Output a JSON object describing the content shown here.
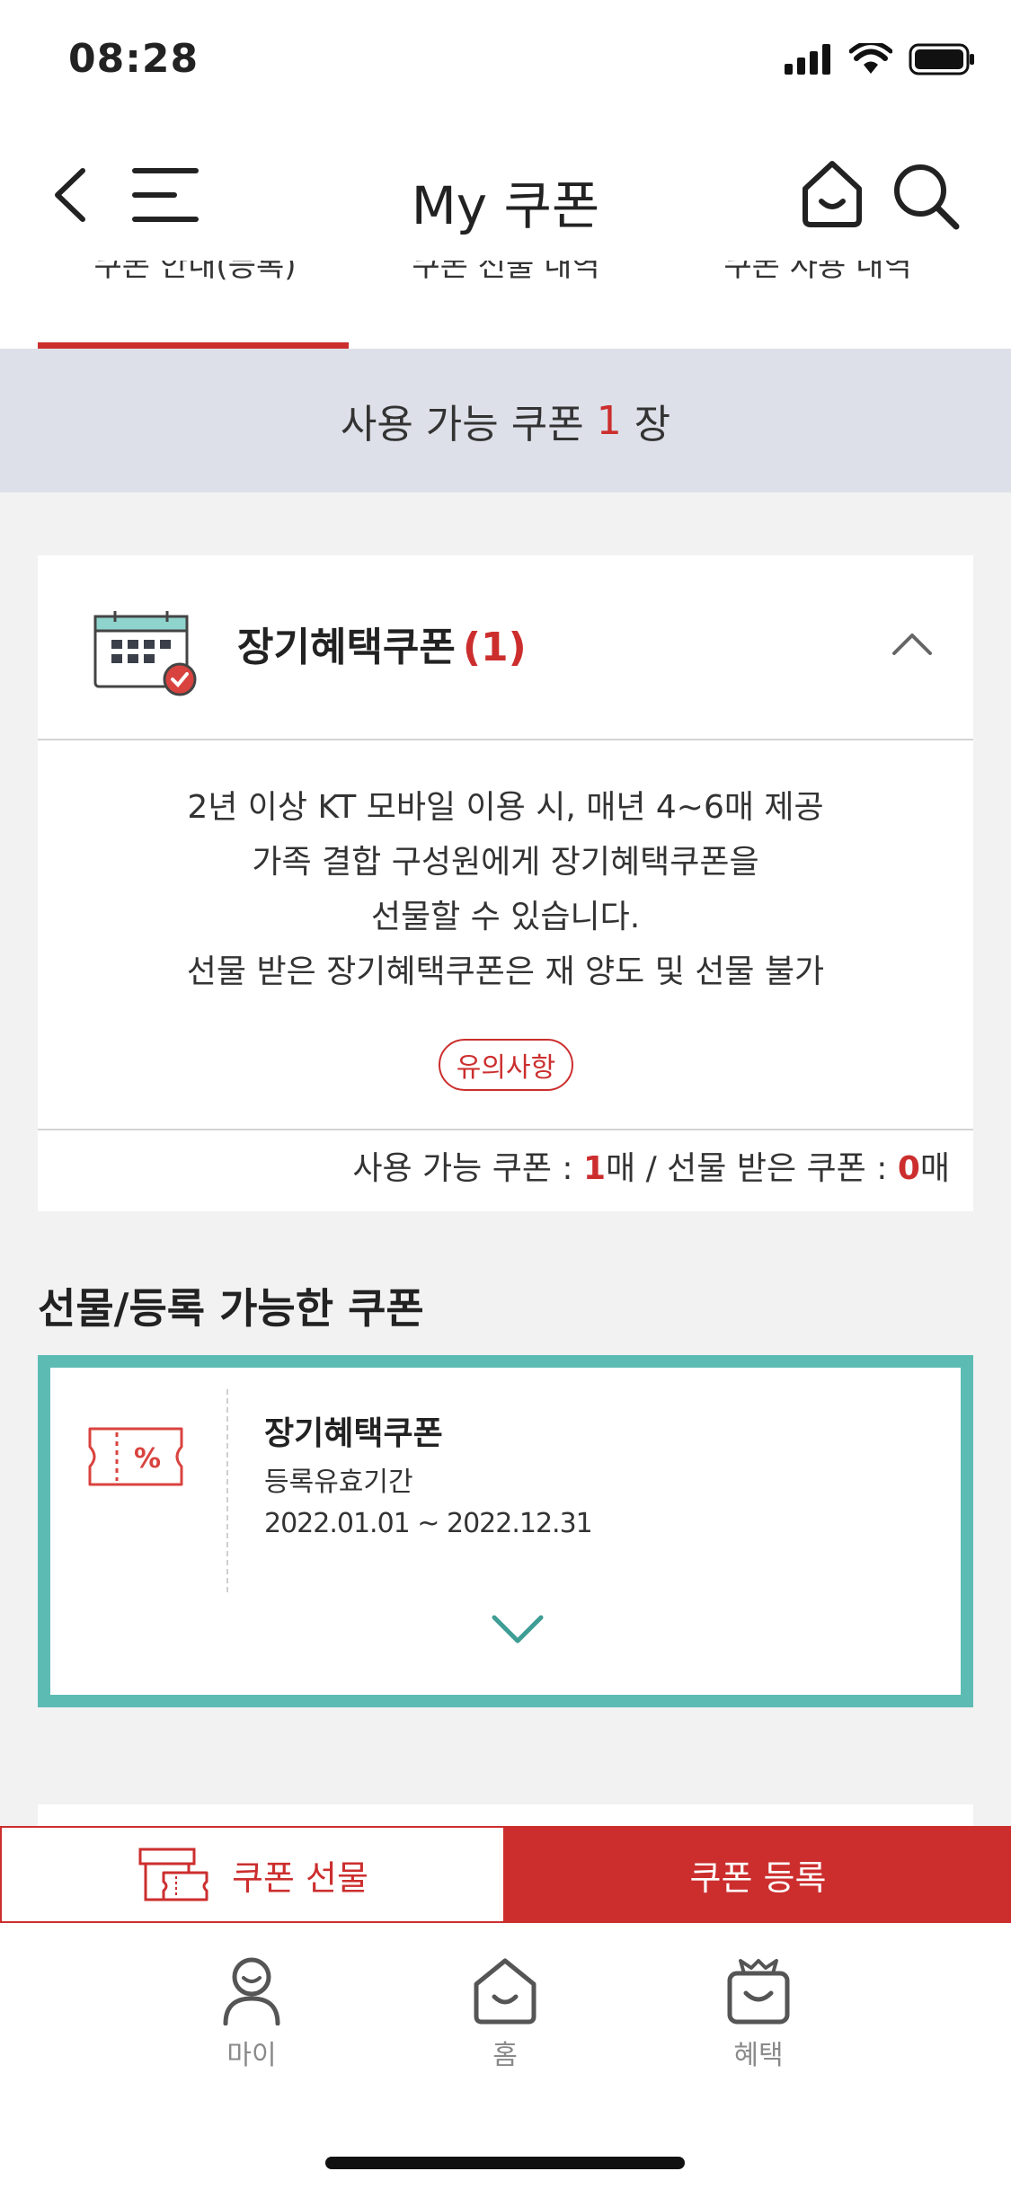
{
  "status_bar": {
    "time": "08:28"
  },
  "nav": {
    "title": "My 쿠폰"
  },
  "tabs": [
    {
      "label": "쿠폰 안내(등록)"
    },
    {
      "label": "쿠폰 선물 내역"
    },
    {
      "label": "쿠폰 사용 내역"
    }
  ],
  "banner": {
    "prefix": "사용 가능 쿠폰 ",
    "count": "1",
    "suffix": " 장"
  },
  "coupon_group": {
    "title": "장기혜택쿠폰",
    "count": "(1)",
    "description": [
      "2년 이상 KT 모바일 이용 시, 매년 4~6매 제공",
      "가족 결합 구성원에게 장기혜택쿠폰을",
      "선물할 수 있습니다.",
      "선물 받은 장기혜택쿠폰은 재 양도 및 선물 불가"
    ],
    "notice_label": "유의사항",
    "footer": {
      "available_label": "사용 가능 쿠폰 : ",
      "available_count": "1",
      "available_unit": "매 / 선물 받은 쿠폰 : ",
      "received_count": "0",
      "received_unit": "매"
    }
  },
  "section": {
    "title": "선물/등록 가능한 쿠폰"
  },
  "ticket": {
    "name": "장기혜택쿠폰",
    "period_label": "등록유효기간",
    "period": "2022.01.01 ~ 2022.12.31",
    "icon": "percent-ticket-icon"
  },
  "actions": {
    "gift_label": "쿠폰 선물",
    "register_label": "쿠폰 등록"
  },
  "tab_bar": [
    {
      "label": "마이",
      "icon": "my-icon"
    },
    {
      "label": "홈",
      "icon": "home-icon"
    },
    {
      "label": "혜택",
      "icon": "gift-icon"
    }
  ],
  "colors": {
    "accent": "#cc2e2e",
    "teal": "#5cbcb4",
    "banner_bg": "#dde0e8",
    "page_bg": "#f2f2f2"
  }
}
